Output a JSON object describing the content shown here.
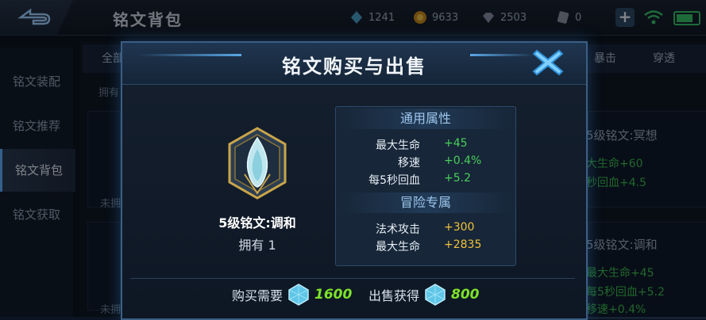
{
  "topbar": {
    "title": "铭文背包",
    "resources": [
      {
        "icon": "diamond-icon",
        "value": "1241"
      },
      {
        "icon": "gold-coin-icon",
        "value": "9633"
      },
      {
        "icon": "gem-icon",
        "value": "2503"
      },
      {
        "icon": "ticket-icon",
        "value": "0"
      }
    ]
  },
  "sidebar": {
    "items": [
      {
        "label": "铭文装配"
      },
      {
        "label": "铭文推荐"
      },
      {
        "label": "铭文背包",
        "active": true
      },
      {
        "label": "铭文获取"
      }
    ]
  },
  "background": {
    "tabs": [
      "全部",
      "暴击",
      "穿透"
    ],
    "owned_label": "拥有",
    "not_owned": [
      "未拥",
      "未拥"
    ],
    "card1": {
      "title": "5级铭文:冥想",
      "lines": [
        "大生命+60",
        "秒回血+4.5"
      ]
    },
    "card2": {
      "title": "5级铭文:调和",
      "lines": [
        "最大生命+45",
        "每5秒回血+5.2",
        "移速+0.4%"
      ]
    }
  },
  "modal": {
    "title": "铭文购买与出售",
    "rune": {
      "name": "5级铭文:调和",
      "owned": "拥有 1"
    },
    "general": {
      "header": "通用属性",
      "attrs": [
        {
          "label": "最大生命",
          "value": "+45"
        },
        {
          "label": "移速",
          "value": "+0.4%"
        },
        {
          "label": "每5秒回血",
          "value": "+5.2"
        }
      ]
    },
    "adventure": {
      "header": "冒险专属",
      "attrs": [
        {
          "label": "法术攻击",
          "value": "+300"
        },
        {
          "label": "最大生命",
          "value": "+2835"
        }
      ]
    },
    "buy": {
      "label": "购买需要",
      "value": "1600"
    },
    "sell": {
      "label": "出售获得",
      "value": "800"
    }
  },
  "colors": {
    "positive_general": "#48d05a",
    "positive_adventure": "#f0c23a",
    "price": "#7de22a",
    "frame": "#3b5f85"
  }
}
